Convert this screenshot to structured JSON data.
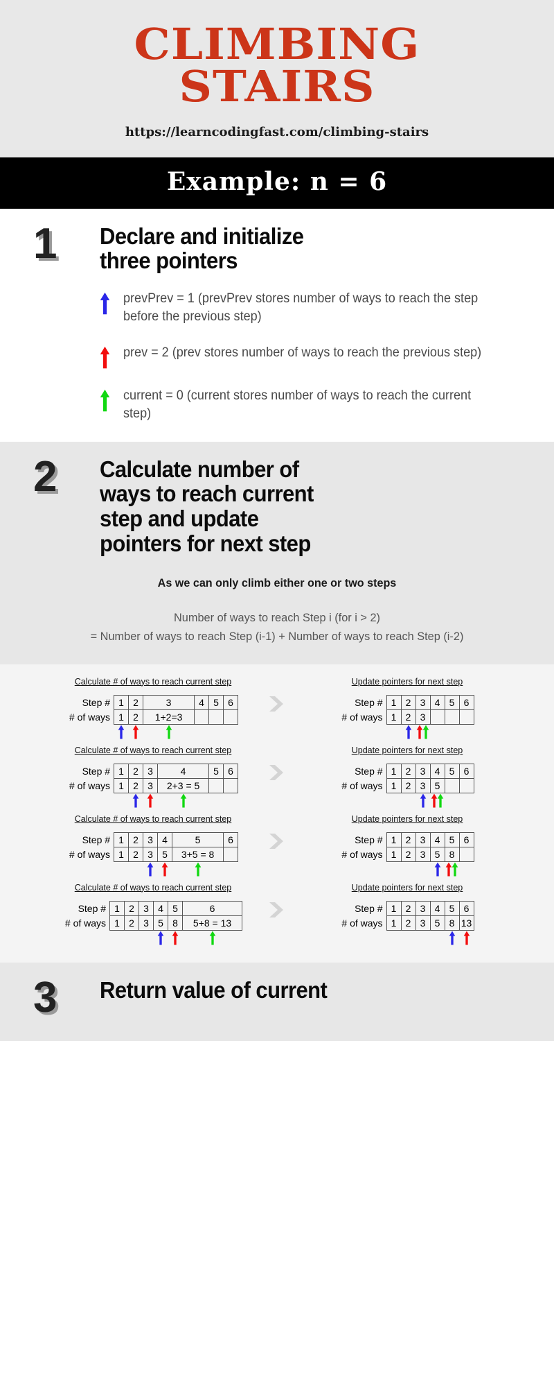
{
  "header": {
    "title_line1": "CLIMBING",
    "title_line2": "STAIRS",
    "url": "https://learncodingfast.com/climbing-stairs",
    "title_color": "#cc3519",
    "bg_color": "#e8e8e8"
  },
  "banner": {
    "text": "Example: n = 6",
    "bg_color": "#000000",
    "text_color": "#ffffff"
  },
  "colors": {
    "prevPrev_arrow": "#2a26e8",
    "prev_arrow": "#f20d0d",
    "current_arrow": "#11d811",
    "step_number": "#222222",
    "step_shadow": "#9a9a9a",
    "chevron": "#d4d4d4"
  },
  "steps": [
    {
      "number": "1",
      "title_lines": [
        "Declare and initialize",
        "three pointers"
      ],
      "bullets": [
        {
          "arrow": "up-arrow-icon-blue",
          "color": "#2a26e8",
          "text": "prevPrev = 1 (prevPrev stores number of ways to reach the step before the previous step)"
        },
        {
          "arrow": "up-arrow-icon-red",
          "color": "#f20d0d",
          "text": "prev = 2 (prev stores number of ways to reach the previous step)"
        },
        {
          "arrow": "up-arrow-icon-green",
          "color": "#11d811",
          "text": "current = 0 (current stores number of ways to reach the current step)"
        }
      ]
    },
    {
      "number": "2",
      "title_lines": [
        "Calculate number of",
        "ways to reach current",
        "step and update",
        "pointers for next step"
      ],
      "note": "As we can only climb either one or two steps",
      "formula_line1": "Number of ways to reach Step i  (for i > 2)",
      "formula_line2": "=  Number of ways to reach Step (i-1)  +  Number of ways to reach Step (i-2)"
    },
    {
      "number": "3",
      "title_prefix": "Return value of ",
      "title_code": "current"
    }
  ],
  "diagram_captions": {
    "left": "Calculate # of ways to reach current step",
    "right": "Update pointers for next step"
  },
  "table_labels": {
    "row1": "Step #",
    "row2": "# of ways"
  },
  "diagrams": [
    {
      "left": {
        "steps": [
          "1",
          "2",
          "3",
          "4",
          "5",
          "6"
        ],
        "ways": [
          "1",
          "2",
          "1+2=3",
          "",
          "",
          ""
        ],
        "wide_col": 2,
        "markers": [
          {
            "col": 0,
            "color": "#2a26e8",
            "name": "prevPrev"
          },
          {
            "col": 1,
            "color": "#f20d0d",
            "name": "prev"
          },
          {
            "col": 2,
            "color": "#11d811",
            "name": "current"
          }
        ]
      },
      "right": {
        "steps": [
          "1",
          "2",
          "3",
          "4",
          "5",
          "6"
        ],
        "ways": [
          "1",
          "2",
          "3",
          "",
          "",
          ""
        ],
        "wide_col": -1,
        "markers": [
          {
            "col": 1,
            "color": "#2a26e8",
            "name": "prevPrev"
          },
          {
            "col": 2,
            "color": "#f20d0d",
            "name": "prev"
          },
          {
            "col": 2,
            "color": "#11d811",
            "name": "current"
          }
        ]
      }
    },
    {
      "left": {
        "steps": [
          "1",
          "2",
          "3",
          "4",
          "5",
          "6"
        ],
        "ways": [
          "1",
          "2",
          "3",
          "2+3 = 5",
          "",
          ""
        ],
        "wide_col": 3,
        "markers": [
          {
            "col": 1,
            "color": "#2a26e8",
            "name": "prevPrev"
          },
          {
            "col": 2,
            "color": "#f20d0d",
            "name": "prev"
          },
          {
            "col": 3,
            "color": "#11d811",
            "name": "current"
          }
        ]
      },
      "right": {
        "steps": [
          "1",
          "2",
          "3",
          "4",
          "5",
          "6"
        ],
        "ways": [
          "1",
          "2",
          "3",
          "5",
          "",
          ""
        ],
        "wide_col": -1,
        "markers": [
          {
            "col": 2,
            "color": "#2a26e8",
            "name": "prevPrev"
          },
          {
            "col": 3,
            "color": "#f20d0d",
            "name": "prev"
          },
          {
            "col": 3,
            "color": "#11d811",
            "name": "current"
          }
        ]
      }
    },
    {
      "left": {
        "steps": [
          "1",
          "2",
          "3",
          "4",
          "5",
          "6"
        ],
        "ways": [
          "1",
          "2",
          "3",
          "5",
          "3+5 = 8",
          ""
        ],
        "wide_col": 4,
        "markers": [
          {
            "col": 2,
            "color": "#2a26e8",
            "name": "prevPrev"
          },
          {
            "col": 3,
            "color": "#f20d0d",
            "name": "prev"
          },
          {
            "col": 4,
            "color": "#11d811",
            "name": "current"
          }
        ]
      },
      "right": {
        "steps": [
          "1",
          "2",
          "3",
          "4",
          "5",
          "6"
        ],
        "ways": [
          "1",
          "2",
          "3",
          "5",
          "8",
          ""
        ],
        "wide_col": -1,
        "markers": [
          {
            "col": 3,
            "color": "#2a26e8",
            "name": "prevPrev"
          },
          {
            "col": 4,
            "color": "#f20d0d",
            "name": "prev"
          },
          {
            "col": 4,
            "color": "#11d811",
            "name": "current"
          }
        ]
      }
    },
    {
      "left": {
        "steps": [
          "1",
          "2",
          "3",
          "4",
          "5",
          "6"
        ],
        "ways": [
          "1",
          "2",
          "3",
          "5",
          "8",
          "5+8 = 13"
        ],
        "wide_col": 5,
        "markers": [
          {
            "col": 3,
            "color": "#2a26e8",
            "name": "prevPrev"
          },
          {
            "col": 4,
            "color": "#f20d0d",
            "name": "prev"
          },
          {
            "col": 5,
            "color": "#11d811",
            "name": "current"
          }
        ]
      },
      "right": {
        "steps": [
          "1",
          "2",
          "3",
          "4",
          "5",
          "6"
        ],
        "ways": [
          "1",
          "2",
          "3",
          "5",
          "8",
          "13"
        ],
        "wide_col": -1,
        "markers": [
          {
            "col": 4,
            "color": "#2a26e8",
            "name": "prevPrev"
          },
          {
            "col": 5,
            "color": "#f20d0d",
            "name": "prev"
          }
        ]
      }
    }
  ]
}
